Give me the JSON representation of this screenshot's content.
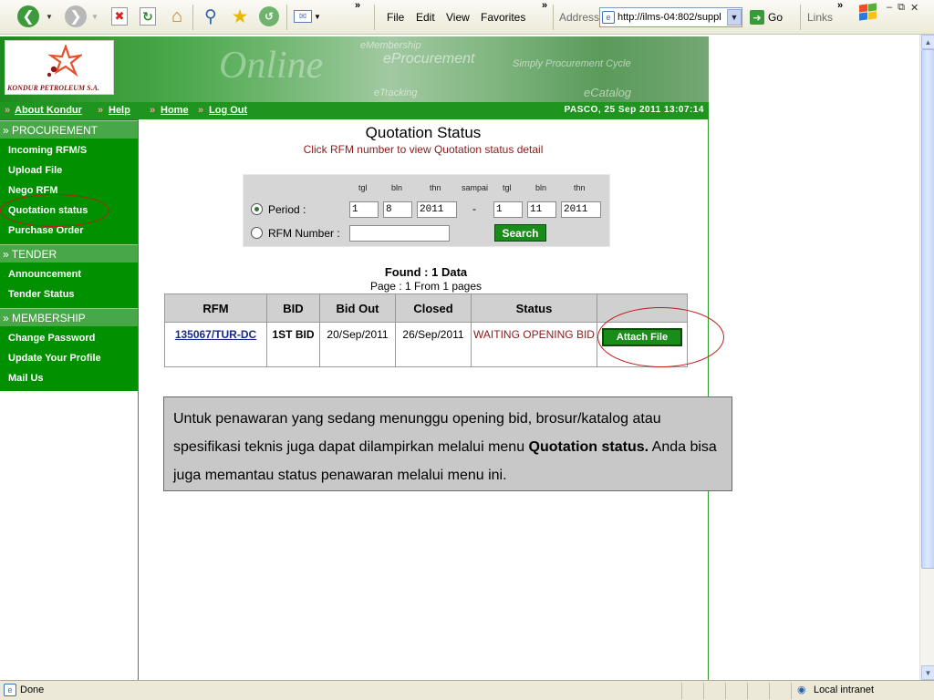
{
  "browser": {
    "menu": [
      "File",
      "Edit",
      "View",
      "Favorites"
    ],
    "address_label": "Address",
    "address_url": "http://ilms-04:802/suppl",
    "go_label": "Go",
    "links_label": "Links"
  },
  "statusbar": {
    "text": "Done",
    "zone": "Local intranet"
  },
  "banner": {
    "logo_text": "KONDUR PETROLEUM S.A.",
    "watermark": "Online",
    "words": [
      "eMembership",
      "eProcurement",
      "Simply Procurement Cycle",
      "eTracking",
      "eCatalog"
    ]
  },
  "nav": {
    "links": [
      "About Kondur",
      "Help",
      "Home",
      "Log Out"
    ],
    "datetime": "PASCO, 25 Sep 2011 13:07:14"
  },
  "sidebar": {
    "procurement_head": "» PROCUREMENT",
    "procurement_items": [
      "Incoming RFM/S",
      "Upload File",
      "Nego RFM",
      "Quotation status",
      "Purchase Order"
    ],
    "tender_head": "» TENDER",
    "tender_items": [
      "Announcement",
      "Tender Status"
    ],
    "membership_head": "» MEMBERSHIP",
    "membership_items": [
      "Change Password",
      "Update Your Profile",
      "Mail Us"
    ]
  },
  "page": {
    "title": "Quotation Status",
    "subtitle": "Click RFM number to view Quotation status detail"
  },
  "filter": {
    "labels": {
      "tgl": "tgl",
      "bln": "bln",
      "thn": "thn",
      "sampai": "sampai"
    },
    "period_label": "Period :",
    "rfm_label": "RFM Number :",
    "from": {
      "tgl": "1",
      "bln": "8",
      "thn": "2011"
    },
    "dash": "-",
    "to": {
      "tgl": "1",
      "bln": "11",
      "thn": "2011"
    },
    "rfm_value": "",
    "search_label": "Search"
  },
  "results": {
    "found": "Found : 1 Data",
    "pages": "Page : 1 From 1 pages",
    "columns": [
      "RFM",
      "BID",
      "Bid Out",
      "Closed",
      "Status",
      ""
    ],
    "rows": [
      {
        "rfm": "135067/TUR-DC",
        "bid": "1ST BID",
        "bid_out": "20/Sep/2011",
        "closed": "26/Sep/2011",
        "status": "WAITING OPENING BID",
        "action": "Attach File"
      }
    ]
  },
  "note": {
    "text_1": "Untuk penawaran yang sedang menunggu opening bid, brosur/katalog atau spesifikasi teknis juga dapat dilampirkan melalui menu ",
    "text_bold": "Quotation status.",
    "text_2": " Anda bisa juga memantau status penawaran melalui menu ini."
  },
  "colors": {
    "brand_green": "#009000",
    "highlight_red": "#c21a1a",
    "status_red": "#8b1a1a"
  }
}
